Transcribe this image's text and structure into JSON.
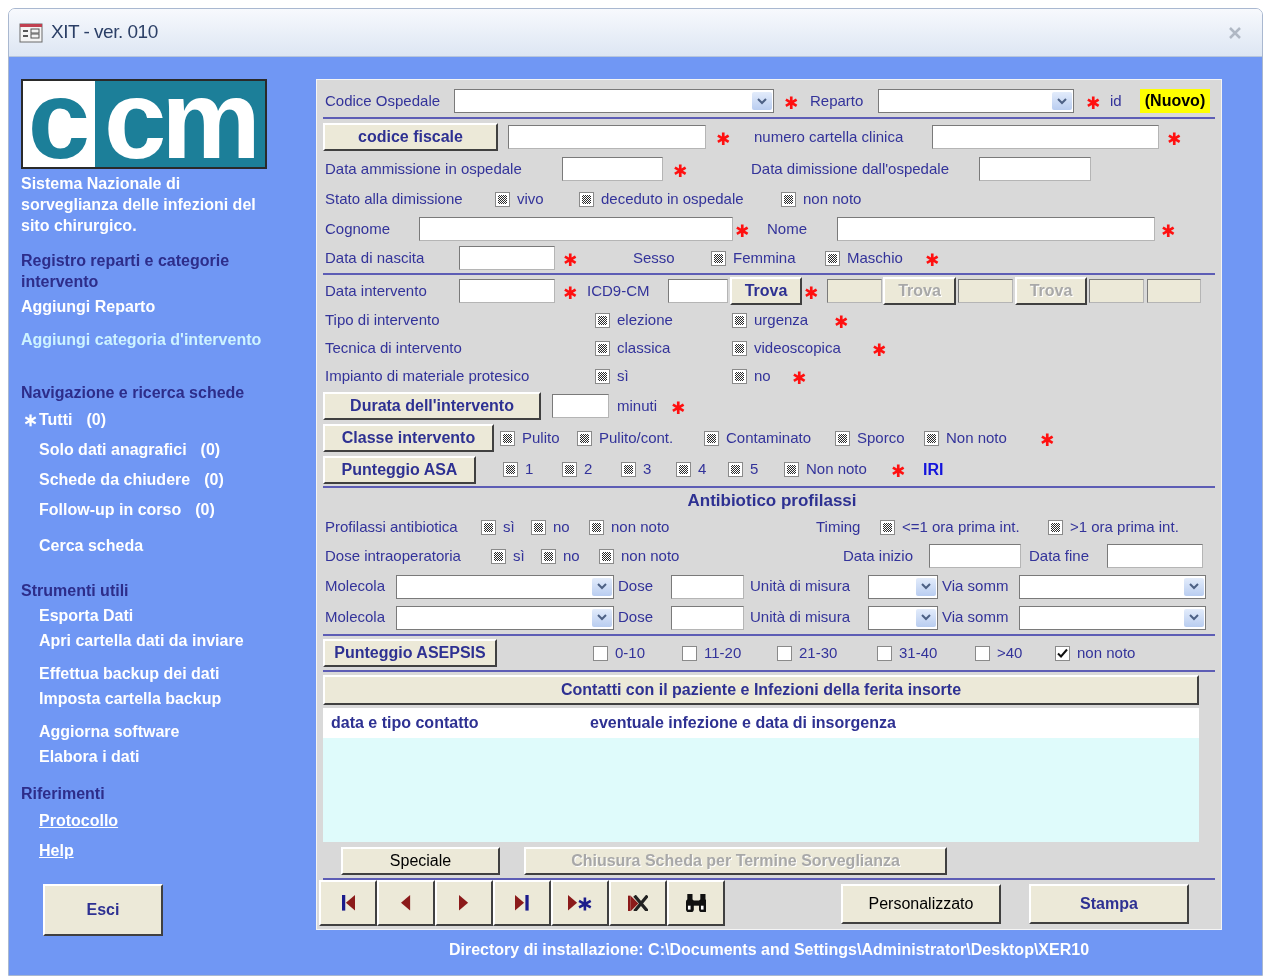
{
  "window": {
    "title": "XIT - ver. 010"
  },
  "sidebar": {
    "logo": [
      "c",
      "cm"
    ],
    "subtitle": "Sistema Nazionale di sorveglianza delle infezioni del sito chirurgico.",
    "sections": [
      {
        "heading": "Registro reparti e categorie intervento",
        "groups": [
          [
            {
              "label": "Aggiungi Reparto",
              "kind": "command",
              "highlighted": false
            }
          ],
          [
            {
              "label": "Aggiungi categoria d'intervento",
              "kind": "command",
              "highlighted": true
            }
          ]
        ]
      },
      {
        "heading": "Navigazione e ricerca schede",
        "groups": [
          [
            {
              "marker": "∗",
              "label": "Tutti",
              "count": "(0)",
              "kind": "command",
              "highlighted": false
            },
            {
              "label": "Solo dati anagrafici",
              "count": "(0)",
              "kind": "command",
              "highlighted": false
            },
            {
              "label": "Schede da chiudere",
              "count": "(0)",
              "kind": "command",
              "highlighted": false
            },
            {
              "label": "Follow-up in corso",
              "count": "(0)",
              "kind": "command",
              "highlighted": false
            }
          ],
          [
            {
              "label": "Cerca scheda",
              "kind": "command",
              "highlighted": false
            }
          ]
        ]
      },
      {
        "heading": "Strumenti utili",
        "groups": [
          [
            {
              "label": "Esporta Dati",
              "kind": "command",
              "highlighted": false
            },
            {
              "label": "Apri cartella dati da inviare",
              "kind": "command",
              "highlighted": false
            }
          ],
          [
            {
              "label": "Effettua backup dei dati",
              "kind": "command",
              "highlighted": false
            },
            {
              "label": "Imposta cartella backup",
              "kind": "command",
              "highlighted": false
            }
          ],
          [
            {
              "label": "Aggiorna software",
              "kind": "command",
              "highlighted": false
            },
            {
              "label": "Elabora i dati",
              "kind": "command",
              "highlighted": false
            }
          ]
        ]
      },
      {
        "heading": "Riferimenti",
        "groups": [
          [
            {
              "label": "Protocollo",
              "kind": "hyperlink",
              "highlighted": false
            },
            {
              "label": "Help",
              "kind": "hyperlink",
              "highlighted": false
            }
          ]
        ]
      }
    ],
    "exit_button": "Esci"
  },
  "form": {
    "groups": [
      {
        "lines": [
          {
            "fields": [
              {
                "kind": "label",
                "text": "Codice Ospedale"
              },
              {
                "kind": "select"
              },
              {
                "kind": "star",
                "text": "✱"
              },
              {
                "kind": "label",
                "text": "Reparto"
              },
              {
                "kind": "select"
              },
              {
                "kind": "star",
                "text": "✱"
              },
              {
                "kind": "label",
                "text": "id"
              },
              {
                "kind": "badge",
                "text": "(Nuovo)"
              }
            ]
          }
        ]
      },
      {
        "lines": [
          {
            "fields": [
              {
                "kind": "button",
                "text": "codice fiscale",
                "disabled": false
              },
              {
                "kind": "input",
                "disabled": false
              },
              {
                "kind": "star",
                "text": "✱"
              },
              {
                "kind": "label",
                "text": "numero cartella clinica"
              },
              {
                "kind": "input",
                "disabled": false
              },
              {
                "kind": "star",
                "text": "✱"
              }
            ]
          },
          {
            "fields": [
              {
                "kind": "label",
                "text": "Data ammissione in ospedale"
              },
              {
                "kind": "input",
                "disabled": false
              },
              {
                "kind": "star",
                "text": "✱"
              },
              {
                "kind": "label",
                "text": "Data dimissione dall'ospedale"
              },
              {
                "kind": "input",
                "disabled": false
              }
            ]
          },
          {
            "fields": [
              {
                "kind": "label",
                "text": "Stato alla dimissione"
              },
              {
                "kind": "checkbox",
                "label": "vivo",
                "indeterminate": true
              },
              {
                "kind": "checkbox",
                "label": "deceduto in ospedale",
                "indeterminate": true
              },
              {
                "kind": "checkbox",
                "label": "non noto",
                "indeterminate": true
              }
            ]
          },
          {
            "fields": [
              {
                "kind": "label",
                "text": "Cognome"
              },
              {
                "kind": "input",
                "disabled": false
              },
              {
                "kind": "star",
                "text": "✱"
              },
              {
                "kind": "label",
                "text": "Nome"
              },
              {
                "kind": "input",
                "disabled": false
              },
              {
                "kind": "star",
                "text": "✱"
              }
            ]
          },
          {
            "fields": [
              {
                "kind": "label",
                "text": "Data di nascita"
              },
              {
                "kind": "input",
                "disabled": false
              },
              {
                "kind": "star",
                "text": "✱"
              },
              {
                "kind": "label",
                "text": "Sesso"
              },
              {
                "kind": "checkbox",
                "label": "Femmina",
                "indeterminate": true
              },
              {
                "kind": "checkbox",
                "label": "Maschio",
                "indeterminate": true
              },
              {
                "kind": "star",
                "text": "✱"
              }
            ]
          }
        ]
      },
      {
        "lines": [
          {
            "fields": [
              {
                "kind": "label",
                "text": "Data intervento"
              },
              {
                "kind": "input",
                "disabled": false
              },
              {
                "kind": "star",
                "text": "✱"
              },
              {
                "kind": "label",
                "text": "ICD9-CM"
              },
              {
                "kind": "input",
                "disabled": false
              },
              {
                "kind": "button",
                "text": "Trova",
                "disabled": false
              },
              {
                "kind": "star",
                "text": "✱"
              },
              {
                "kind": "input",
                "disabled": true
              },
              {
                "kind": "button",
                "text": "Trova",
                "disabled": true
              },
              {
                "kind": "input",
                "disabled": true
              },
              {
                "kind": "button",
                "text": "Trova",
                "disabled": true
              },
              {
                "kind": "input",
                "disabled": true
              },
              {
                "kind": "input",
                "disabled": true
              }
            ]
          },
          {
            "fields": [
              {
                "kind": "label",
                "text": "Tipo di intervento"
              },
              {
                "kind": "checkbox",
                "label": "elezione",
                "indeterminate": true
              },
              {
                "kind": "checkbox",
                "label": "urgenza",
                "indeterminate": true
              },
              {
                "kind": "star",
                "text": "✱"
              }
            ]
          },
          {
            "fields": [
              {
                "kind": "label",
                "text": "Tecnica di intervento"
              },
              {
                "kind": "checkbox",
                "label": "classica",
                "indeterminate": true
              },
              {
                "kind": "checkbox",
                "label": "videoscopica",
                "indeterminate": true
              },
              {
                "kind": "star",
                "text": "✱"
              }
            ]
          },
          {
            "fields": [
              {
                "kind": "label",
                "text": "Impianto di materiale protesico"
              },
              {
                "kind": "checkbox",
                "label": "sì",
                "indeterminate": true
              },
              {
                "kind": "checkbox",
                "label": "no",
                "indeterminate": true
              },
              {
                "kind": "star",
                "text": "✱"
              }
            ]
          },
          {
            "fields": [
              {
                "kind": "button",
                "text": "Durata dell'intervento",
                "disabled": false
              },
              {
                "kind": "input",
                "disabled": false
              },
              {
                "kind": "label",
                "text": "minuti"
              },
              {
                "kind": "star",
                "text": "✱"
              }
            ]
          },
          {
            "fields": [
              {
                "kind": "button",
                "text": "Classe intervento",
                "disabled": false
              },
              {
                "kind": "checkbox",
                "label": "Pulito",
                "indeterminate": true
              },
              {
                "kind": "checkbox",
                "label": "Pulito/cont.",
                "indeterminate": true
              },
              {
                "kind": "checkbox",
                "label": "Contaminato",
                "indeterminate": true
              },
              {
                "kind": "checkbox",
                "label": "Sporco",
                "indeterminate": true
              },
              {
                "kind": "checkbox",
                "label": "Non noto",
                "indeterminate": true
              },
              {
                "kind": "star",
                "text": "✱"
              }
            ]
          },
          {
            "fields": [
              {
                "kind": "button",
                "text": "Punteggio ASA",
                "disabled": false
              },
              {
                "kind": "checkbox",
                "label": "1",
                "indeterminate": true
              },
              {
                "kind": "checkbox",
                "label": "2",
                "indeterminate": true
              },
              {
                "kind": "checkbox",
                "label": "3",
                "indeterminate": true
              },
              {
                "kind": "checkbox",
                "label": "4",
                "indeterminate": true
              },
              {
                "kind": "checkbox",
                "label": "5",
                "indeterminate": true
              },
              {
                "kind": "checkbox",
                "label": "Non noto",
                "indeterminate": true
              },
              {
                "kind": "star",
                "text": "✱"
              },
              {
                "kind": "link",
                "text": "IRI"
              }
            ]
          }
        ]
      },
      {
        "title": "Antibiotico profilassi",
        "lines": [
          {
            "fields": [
              {
                "kind": "label",
                "text": "Profilassi antibiotica"
              },
              {
                "kind": "checkbox",
                "label": "sì",
                "indeterminate": true
              },
              {
                "kind": "checkbox",
                "label": "no",
                "indeterminate": true
              },
              {
                "kind": "checkbox",
                "label": "non noto",
                "indeterminate": true
              },
              {
                "kind": "label",
                "text": "Timing"
              },
              {
                "kind": "checkbox",
                "label": "<=1 ora prima int.",
                "indeterminate": true
              },
              {
                "kind": "checkbox",
                "label": ">1 ora prima int.",
                "indeterminate": true
              }
            ]
          },
          {
            "fields": [
              {
                "kind": "label",
                "text": "Dose intraoperatoria"
              },
              {
                "kind": "checkbox",
                "label": "sì",
                "indeterminate": true
              },
              {
                "kind": "checkbox",
                "label": "no",
                "indeterminate": true
              },
              {
                "kind": "checkbox",
                "label": "non noto",
                "indeterminate": true
              },
              {
                "kind": "label",
                "text": "Data inizio"
              },
              {
                "kind": "input",
                "disabled": false
              },
              {
                "kind": "label",
                "text": "Data fine"
              },
              {
                "kind": "input",
                "disabled": false
              }
            ]
          },
          {
            "fields": [
              {
                "kind": "label",
                "text": "Molecola"
              },
              {
                "kind": "select"
              },
              {
                "kind": "label",
                "text": "Dose"
              },
              {
                "kind": "input",
                "disabled": false
              },
              {
                "kind": "label",
                "text": "Unità di misura"
              },
              {
                "kind": "select"
              },
              {
                "kind": "label",
                "text": "Via somm"
              },
              {
                "kind": "select"
              }
            ]
          },
          {
            "fields": [
              {
                "kind": "label",
                "text": "Molecola"
              },
              {
                "kind": "select"
              },
              {
                "kind": "label",
                "text": "Dose"
              },
              {
                "kind": "input",
                "disabled": false
              },
              {
                "kind": "label",
                "text": "Unità di misura"
              },
              {
                "kind": "select"
              },
              {
                "kind": "label",
                "text": "Via somm"
              },
              {
                "kind": "select"
              }
            ]
          }
        ]
      },
      {
        "lines": [
          {
            "fields": [
              {
                "kind": "button",
                "text": "Punteggio ASEPSIS",
                "disabled": false
              },
              {
                "kind": "checkbox",
                "label": "0-10",
                "checked": false
              },
              {
                "kind": "checkbox",
                "label": "11-20",
                "checked": false
              },
              {
                "kind": "checkbox",
                "label": "21-30",
                "checked": false
              },
              {
                "kind": "checkbox",
                "label": "31-40",
                "checked": false
              },
              {
                "kind": "checkbox",
                "label": ">40",
                "checked": false
              },
              {
                "kind": "checkbox",
                "label": "non noto",
                "checked": true
              }
            ]
          }
        ]
      }
    ],
    "contacts": {
      "button": "Contatti con il paziente e Infezioni della ferita insorte",
      "columns": [
        "data e tipo contatto",
        "eventuale infezione e data di insorgenza"
      ]
    },
    "actions": [
      {
        "text": "Speciale",
        "kind": "plain-button",
        "disabled": false
      },
      {
        "text": "Chiusura Scheda per Termine Sorveglianza",
        "kind": "button",
        "disabled": true
      }
    ],
    "navigation": [
      {
        "kind": "first"
      },
      {
        "kind": "previous"
      },
      {
        "kind": "next"
      },
      {
        "kind": "last"
      },
      {
        "kind": "new"
      },
      {
        "kind": "delete"
      },
      {
        "kind": "find"
      }
    ],
    "buttons": [
      {
        "text": "Personalizzato",
        "kind": "plain-button",
        "disabled": false
      },
      {
        "text": "Stampa",
        "kind": "button",
        "disabled": false
      }
    ]
  },
  "status": "Directory di installazione: C:\\Documents and Settings\\Administrator\\Desktop\\XER10"
}
